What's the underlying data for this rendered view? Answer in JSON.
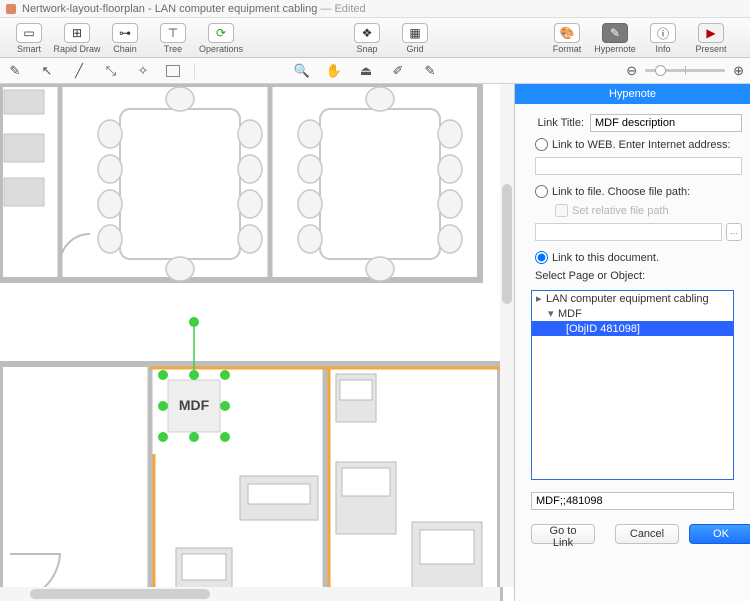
{
  "titlebar": {
    "doc_name": "Nertwork-layout-floorplan",
    "subtitle": "LAN computer equipment cabling",
    "edited": "— Edited"
  },
  "toolbar": {
    "smart": "Smart",
    "rapid": "Rapid Draw",
    "chain": "Chain",
    "tree": "Tree",
    "operations": "Operations",
    "snap": "Snap",
    "grid": "Grid",
    "format": "Format",
    "hypernote": "Hypernote",
    "info": "Info",
    "present": "Present"
  },
  "canvas": {
    "mdf_label": "MDF"
  },
  "panel": {
    "title": "Hypenote",
    "link_title_label": "Link Title:",
    "link_title_value": "MDF description",
    "radio_web": "Link to WEB. Enter Internet address:",
    "radio_file": "Link to file. Choose file path:",
    "check_relative": "Set relative file path",
    "radio_doc": "Link to this document.",
    "select_label": "Select Page or Object:",
    "tree": {
      "root": "LAN computer equipment cabling",
      "mdf": "MDF",
      "obj": "[ObjID 481098]"
    },
    "result_value": "MDF;;481098",
    "btn_go": "Go to Link",
    "btn_cancel": "Cancel",
    "btn_ok": "OK",
    "ellipsis": "..."
  }
}
